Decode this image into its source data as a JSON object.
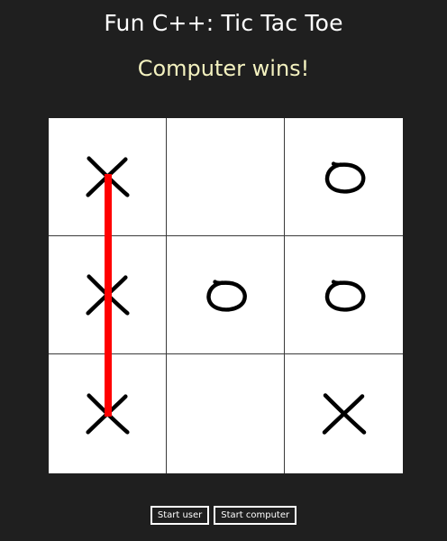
{
  "app": {
    "title": "Fun C++: Tic Tac Toe"
  },
  "game": {
    "status": "Computer wins!",
    "status_color": "#f3f1bf",
    "board": [
      [
        "X",
        "",
        "O"
      ],
      [
        "X",
        "O",
        "O"
      ],
      [
        "X",
        "",
        "X"
      ]
    ],
    "winning_line": {
      "from": [
        0,
        0
      ],
      "to": [
        2,
        0
      ],
      "color": "#ff0000"
    }
  },
  "controls": {
    "start_user_label": "Start user",
    "start_computer_label": "Start computer"
  }
}
